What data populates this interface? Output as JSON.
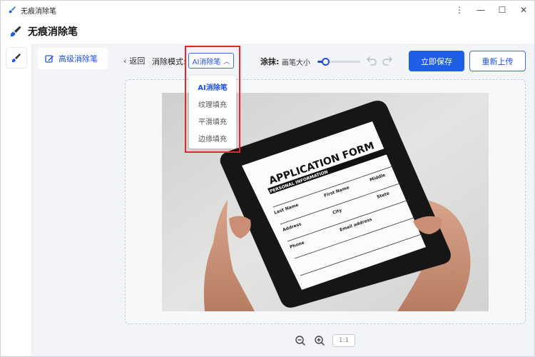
{
  "window": {
    "title": "无痕消除笔",
    "controls": [
      "⋮",
      "—",
      "☐",
      "✕"
    ]
  },
  "app": {
    "title": "无痕消除笔",
    "accent": "#1f5fe8"
  },
  "sidebar": {
    "items": [
      {
        "label": "高级消除笔",
        "icon": "edit-icon",
        "active": true
      }
    ]
  },
  "toolbar": {
    "back_label": "返回",
    "mode_label": "消除模式:",
    "mode_value": "AI消除笔",
    "brush_label": "涂抹:",
    "brush_size_label": "画笔大小",
    "brush_size_level": 0.18,
    "save_label": "立即保存",
    "reupload_label": "重新上传"
  },
  "dropdown": {
    "options": [
      {
        "label": "AI消除笔",
        "selected": true
      },
      {
        "label": "纹理填充",
        "selected": false
      },
      {
        "label": "平滑填充",
        "selected": false
      },
      {
        "label": "边缘填充",
        "selected": false
      }
    ]
  },
  "image": {
    "form_title": "APPLICATION FORM",
    "section": "PERSONAL INFORMATION",
    "fields": [
      "Last Name",
      "First Name",
      "Middle",
      "Address",
      "City",
      "State",
      "Phone",
      "Email address"
    ]
  },
  "zoom": {
    "ratio": "1:1"
  }
}
